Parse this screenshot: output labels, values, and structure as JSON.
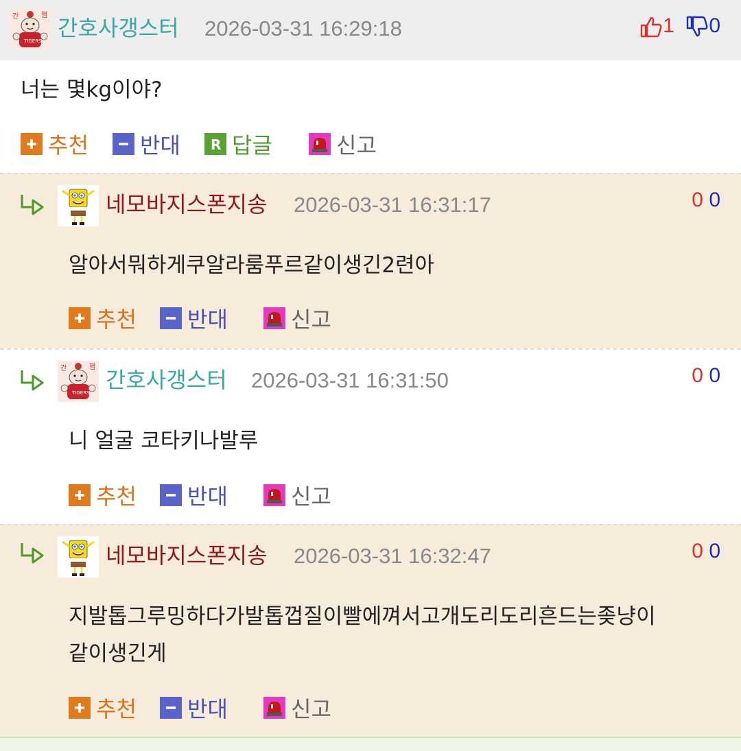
{
  "colors": {
    "header_bg": "#eeeeee",
    "reply_bg_beige": "#f7ebdc",
    "nick_teal": "#3aa8a4",
    "nick_maroon": "#8b1a1a",
    "recommend": "#d9731c",
    "oppose": "#4652b8",
    "reply_green": "#4e9a2a",
    "vote_up": "#d9302c",
    "vote_down": "#1a2fb8"
  },
  "root": {
    "nick": "간호사갱스터",
    "date": "2026-03-31 16:29:18",
    "avatar_icon": "hamster-tigers-avatar-icon",
    "up_count": "1",
    "down_count": "0",
    "text": "너는 몇kg이야?",
    "actions": {
      "recommend": "추천",
      "oppose": "반대",
      "reply": "답글",
      "report": "신고"
    }
  },
  "replies": [
    {
      "nick": "네모바지스폰지송",
      "date": "2026-03-31 16:31:17",
      "avatar_icon": "spongebob-avatar-icon",
      "up_count": "0",
      "down_count": "0",
      "text": "알아서뭐하게쿠알라룸푸르같이생긴2련아",
      "actions": {
        "recommend": "추천",
        "oppose": "반대",
        "report": "신고"
      }
    },
    {
      "nick": "간호사갱스터",
      "date": "2026-03-31 16:31:50",
      "avatar_icon": "hamster-tigers-avatar-icon",
      "up_count": "0",
      "down_count": "0",
      "text": "니 얼굴 코타키나발루",
      "actions": {
        "recommend": "추천",
        "oppose": "반대",
        "report": "신고"
      }
    },
    {
      "nick": "네모바지스폰지송",
      "date": "2026-03-31 16:32:47",
      "avatar_icon": "spongebob-avatar-icon",
      "up_count": "0",
      "down_count": "0",
      "text_line1": "지발톱그루밍하다가발톱껍질이빨에껴서고개도리도리흔드는좆냥이",
      "text_line2": "같이생긴게",
      "actions": {
        "recommend": "추천",
        "oppose": "반대",
        "report": "신고"
      }
    }
  ]
}
